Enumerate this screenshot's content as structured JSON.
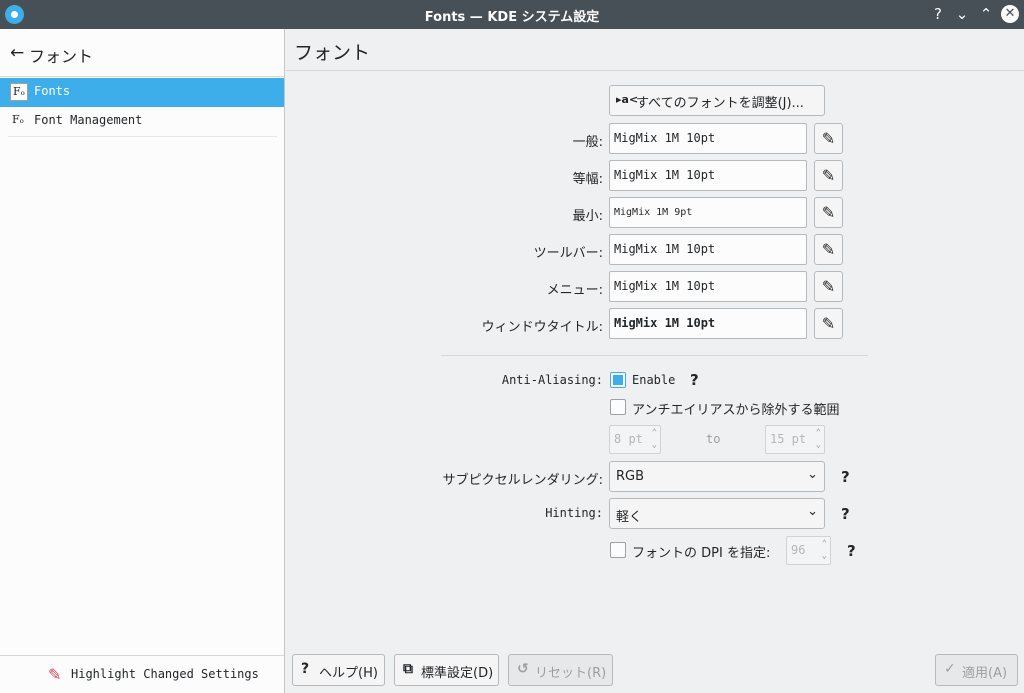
{
  "window": {
    "title": "Fonts — KDE システム設定",
    "help_glyph": "?",
    "minimize_glyph": "⌄",
    "maximize_glyph": "⌃",
    "close_glyph": "✕"
  },
  "sidebar": {
    "header": {
      "back_glyph": "←",
      "label": "フォント"
    },
    "items": [
      {
        "icon_text": "Fₒ",
        "label": "Fonts",
        "selected": true
      },
      {
        "icon_text": "Fₒ",
        "label": "Font Management",
        "selected": false
      }
    ],
    "footer": {
      "brush_glyph": "✎",
      "label": "Highlight Changed Settings"
    }
  },
  "main": {
    "title": "フォント",
    "adjust_button": {
      "icon_text": "▸a<",
      "label": "すべてのフォントを調整(J)..."
    },
    "edit_glyph": "✎",
    "font_rows": [
      {
        "label": "一般:",
        "value": "MigMix 1M 10pt"
      },
      {
        "label": "等幅:",
        "value": "MigMix 1M 10pt"
      },
      {
        "label": "最小:",
        "value": "MigMix 1M 9pt"
      },
      {
        "label": "ツールバー:",
        "value": "MigMix 1M 10pt"
      },
      {
        "label": "メニュー:",
        "value": "MigMix 1M 10pt"
      },
      {
        "label": "ウィンドウタイトル:",
        "value": "MigMix 1M 10pt"
      }
    ],
    "anti_aliasing": {
      "label": "Anti-Aliasing:",
      "enable_label": "Enable",
      "enable_checked": true,
      "exclude_label": "アンチエイリアスから除外する範囲",
      "exclude_checked": false,
      "from_value": "8 pt",
      "to_label": "to",
      "to_value": "15 pt"
    },
    "subpixel": {
      "label": "サブピクセルレンダリング:",
      "value": "RGB"
    },
    "hinting": {
      "label": "Hinting:",
      "value": "軽く"
    },
    "dpi": {
      "label": "フォントの DPI を指定:",
      "checked": false,
      "value": "96"
    },
    "help_glyph": "?",
    "chevron_glyph": "⌄",
    "spin_glyph_up": "⌃",
    "spin_glyph_down": "⌄"
  },
  "buttons": {
    "help": {
      "icon": "?",
      "label": "ヘルプ(H)"
    },
    "defaults": {
      "icon": "⧉",
      "label": "標準設定(D)"
    },
    "reset": {
      "icon": "↺",
      "label": "リセット(R)"
    },
    "apply": {
      "icon": "✓",
      "label": "適用(A)"
    }
  },
  "colors": {
    "accent": "#3daee9",
    "titlebar": "#475057",
    "highlight_brush": "#da4453"
  }
}
